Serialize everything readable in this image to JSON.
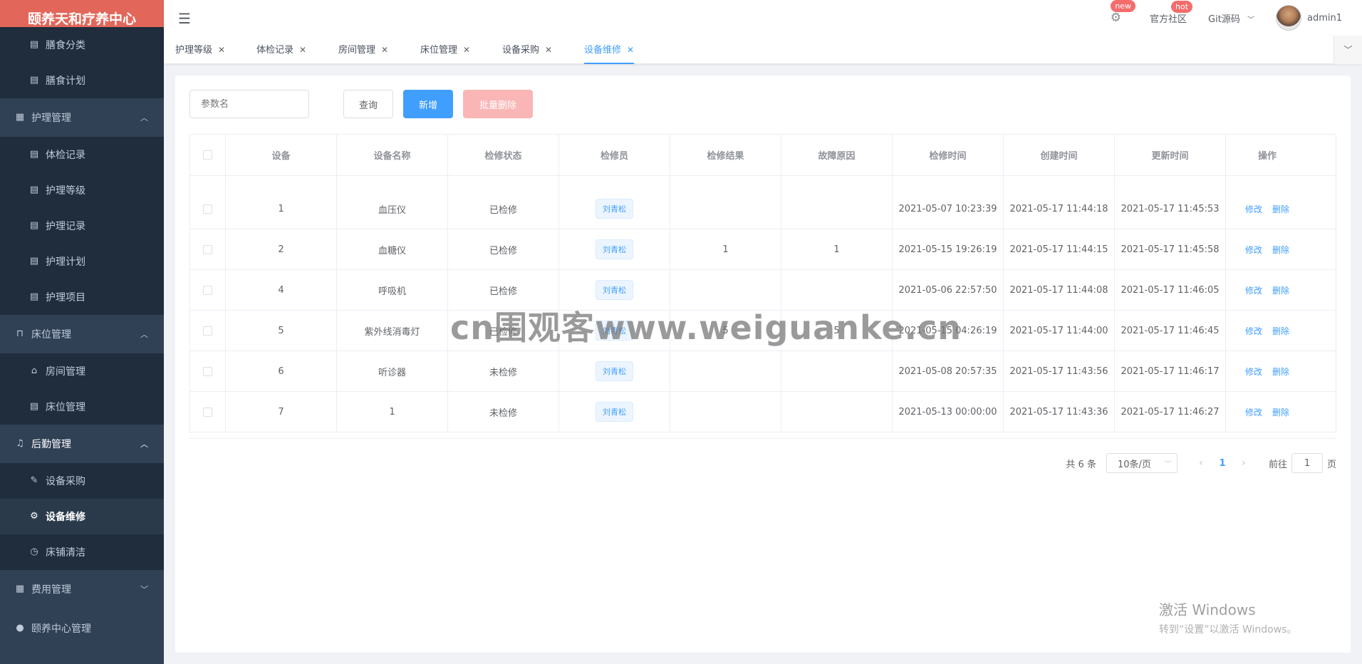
{
  "app": {
    "title": "颐养天和疗养中心"
  },
  "sidebar": {
    "items": [
      {
        "label": "膳食分类",
        "icon": "doc-icon",
        "type": "sub"
      },
      {
        "label": "膳食计划",
        "icon": "doc-icon",
        "type": "sub"
      },
      {
        "label": "护理管理",
        "icon": "grid-icon",
        "type": "group",
        "arrow": "up"
      },
      {
        "label": "体检记录",
        "icon": "doc-icon",
        "type": "sub"
      },
      {
        "label": "护理等级",
        "icon": "doc-icon",
        "type": "sub"
      },
      {
        "label": "护理记录",
        "icon": "doc-icon",
        "type": "sub"
      },
      {
        "label": "护理计划",
        "icon": "doc-icon",
        "type": "sub"
      },
      {
        "label": "护理项目",
        "icon": "doc-icon",
        "type": "sub"
      },
      {
        "label": "床位管理",
        "icon": "lock-icon",
        "type": "group",
        "arrow": "up"
      },
      {
        "label": "房间管理",
        "icon": "home-icon",
        "type": "sub"
      },
      {
        "label": "床位管理",
        "icon": "doc-icon",
        "type": "sub"
      },
      {
        "label": "后勤管理",
        "icon": "bell-icon",
        "type": "group",
        "arrow": "up"
      },
      {
        "label": "设备采购",
        "icon": "edit-icon",
        "type": "sub"
      },
      {
        "label": "设备维修",
        "icon": "gear-icon",
        "type": "sub"
      },
      {
        "label": "床铺清洁",
        "icon": "clock-icon",
        "type": "sub"
      },
      {
        "label": "费用管理",
        "icon": "grid-icon",
        "type": "group",
        "arrow": "down"
      },
      {
        "label": "颐养中心管理",
        "icon": "user-icon",
        "type": "group",
        "arrow": ""
      }
    ]
  },
  "header": {
    "new_badge": "new",
    "community": "官方社区",
    "hot_badge": "hot",
    "git": "Git源码",
    "user": "admin1"
  },
  "tabs": [
    {
      "label": "护理等级"
    },
    {
      "label": "体检记录"
    },
    {
      "label": "房间管理"
    },
    {
      "label": "床位管理"
    },
    {
      "label": "设备采购"
    },
    {
      "label": "设备维修"
    }
  ],
  "toolbar": {
    "search_placeholder": "参数名",
    "query": "查询",
    "add": "新增",
    "batch_delete": "批量删除"
  },
  "table": {
    "columns": [
      "设备",
      "设备名称",
      "检修状态",
      "检修员",
      "检修结果",
      "故障原因",
      "检修时间",
      "创建时间",
      "更新时间",
      "操作"
    ],
    "rows": [
      {
        "id": "1",
        "name": "血压仪",
        "status": "已检修",
        "staff": "刘青松",
        "result": "",
        "reason": "",
        "repair_time": "2021-05-07 10:23:39",
        "created": "2021-05-17 11:44:18",
        "updated": "2021-05-17 11:45:53"
      },
      {
        "id": "2",
        "name": "血糖仪",
        "status": "已检修",
        "staff": "刘青松",
        "result": "1",
        "reason": "1",
        "repair_time": "2021-05-15 19:26:19",
        "created": "2021-05-17 11:44:15",
        "updated": "2021-05-17 11:45:58"
      },
      {
        "id": "4",
        "name": "呼吸机",
        "status": "已检修",
        "staff": "刘青松",
        "result": "",
        "reason": "",
        "repair_time": "2021-05-06 22:57:50",
        "created": "2021-05-17 11:44:08",
        "updated": "2021-05-17 11:46:05"
      },
      {
        "id": "5",
        "name": "紫外线消毒灯",
        "status": "已检修",
        "staff": "刘青松",
        "result": "5",
        "reason": "5",
        "repair_time": "2021-05-15 04:26:19",
        "created": "2021-05-17 11:44:00",
        "updated": "2021-05-17 11:46:45"
      },
      {
        "id": "6",
        "name": "听诊器",
        "status": "未检修",
        "staff": "刘青松",
        "result": "",
        "reason": "",
        "repair_time": "2021-05-08 20:57:35",
        "created": "2021-05-17 11:43:56",
        "updated": "2021-05-17 11:46:17"
      },
      {
        "id": "7",
        "name": "1",
        "status": "未检修",
        "staff": "刘青松",
        "result": "",
        "reason": "",
        "repair_time": "2021-05-13 00:00:00",
        "created": "2021-05-17 11:43:36",
        "updated": "2021-05-17 11:46:27"
      }
    ],
    "edit_label": "修改",
    "delete_label": "删除"
  },
  "pagination": {
    "total": "共 6 条",
    "page_size": "10条/页",
    "current_page": "1",
    "goto_label": "前往",
    "goto_value": "1",
    "page_suffix": "页"
  },
  "watermark": "cn围观客www.weiguanke.cn",
  "os_notice": {
    "line1": "激活 Windows",
    "line2": "转到“设置”以激活 Windows。"
  },
  "colors": {
    "primary": "#409eff",
    "sidebar": "#304156",
    "logo": "#e2665a",
    "danger": "#f56c6c"
  }
}
